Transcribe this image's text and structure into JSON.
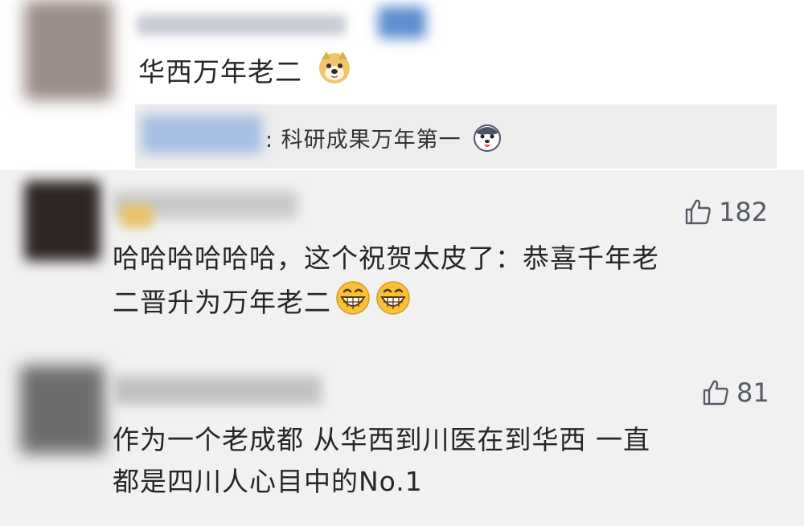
{
  "top_comment": {
    "text": "华西万年老二",
    "emoji_icon": "doge-emoji",
    "reply": {
      "text": ": 科研成果万年第一",
      "emoji_icon": "husky-emoji"
    }
  },
  "comments": [
    {
      "likes": "182",
      "like_icon": "thumbs-up-icon",
      "lines": [
        "哈哈哈哈哈哈，这个祝贺太皮了：恭喜千年老",
        "二晋升为万年老二"
      ],
      "emoji_icon": "grin-emoji"
    },
    {
      "likes": "81",
      "like_icon": "thumbs-up-icon",
      "lines": [
        "作为一个老成都 从华西到川医在到华西 一直",
        "都是四川人心目中的No.1"
      ]
    }
  ],
  "colors": {
    "background": "#f1f1f1",
    "card": "#ffffff",
    "reply_bg": "#ededed",
    "text": "#262626",
    "like": "#555b66"
  }
}
